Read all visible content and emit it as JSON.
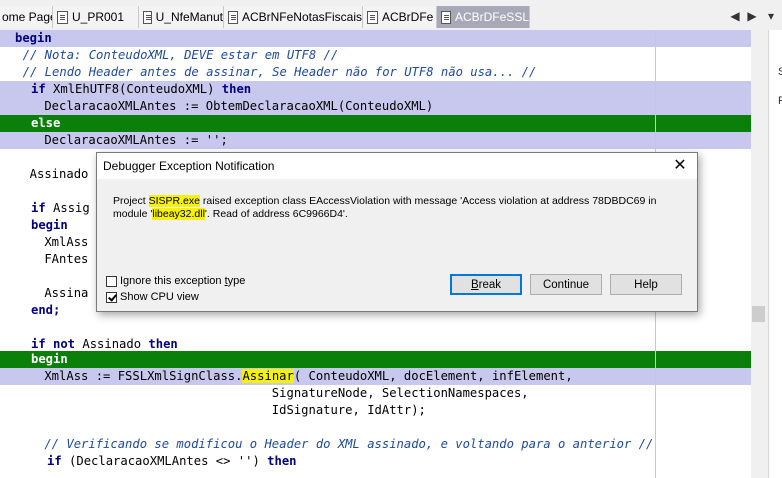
{
  "tabs": [
    {
      "label": "ome Page"
    },
    {
      "label": "U_PR001"
    },
    {
      "label": "U_NfeManut"
    },
    {
      "label": "ACBrNFeNotasFiscais"
    },
    {
      "label": "ACBrDFe"
    },
    {
      "label": "ACBrDFeSSL"
    }
  ],
  "nav": {
    "left": "◀",
    "right": "▶",
    "dropdown": "▾"
  },
  "code": {
    "l1": "begin",
    "l2": "  // Nota: ConteudoXML, DEVE estar em UTF8 //",
    "l3": "  // Lendo Header antes de assinar, Se Header não for UTF8 não usa... //",
    "l4_kw1": "if",
    "l4_mid": " XmlEhUTF8(ConteudoXML) ",
    "l4_kw2": "then",
    "l5": "    DeclaracaoXMLAntes := ObtemDeclaracaoXML(ConteudoXML)",
    "l6": "else",
    "l7": "    DeclaracaoXMLAntes := '';",
    "l8": "  Assinado",
    "l9_kw": "if",
    "l9_rest": " Assig",
    "l10": "begin",
    "l11": "    XmlAss",
    "l12": "    FAntes",
    "l13": "    Assina",
    "l14": "end;",
    "l15_kw1": "if not",
    "l15_mid": " Assinado ",
    "l15_kw2": "then",
    "l16": "begin",
    "l17_a": "    XmlAss := FSSLXmlSignClass.",
    "l17_mark": "Assinar",
    "l17_b": "( ConteudoXML, docElement, infElement,",
    "l18": "                                   SignatureNode, SelectionNamespaces,",
    "l19": "                                   IdSignature, IdAttr);",
    "l20": "    // Verificando se modificou o Header do XML assinado, e voltando para o anterior //",
    "l21_kw": "if",
    "l21_mid": " (DeclaracaoXMLAntes <> '') ",
    "l21_kw2": "then"
  },
  "side": {
    "t1": "S",
    "t2": "F"
  },
  "dialog": {
    "title": "Debugger Exception Notification",
    "close": "✕",
    "msg_a": "Project ",
    "msg_mark1": "SISPR.exe",
    "msg_b": " raised exception class EAccessViolation with message 'Access violation at address 78DBDC69 in module '",
    "msg_mark2": "libeay32.dll",
    "msg_c": "'. Read of address 6C9966D4'.",
    "ignore_label": "Ignore this exception type",
    "ignore_checked": false,
    "cpu_label": "Show CPU view",
    "cpu_checked": true,
    "break_label": "Break",
    "continue_label": "Continue",
    "help_label": "Help"
  },
  "colors": {
    "highlight": "#c8c8ee",
    "green_line": "#0a800a",
    "marker": "#f6f10a",
    "active_tab": "#a8a8b8"
  }
}
